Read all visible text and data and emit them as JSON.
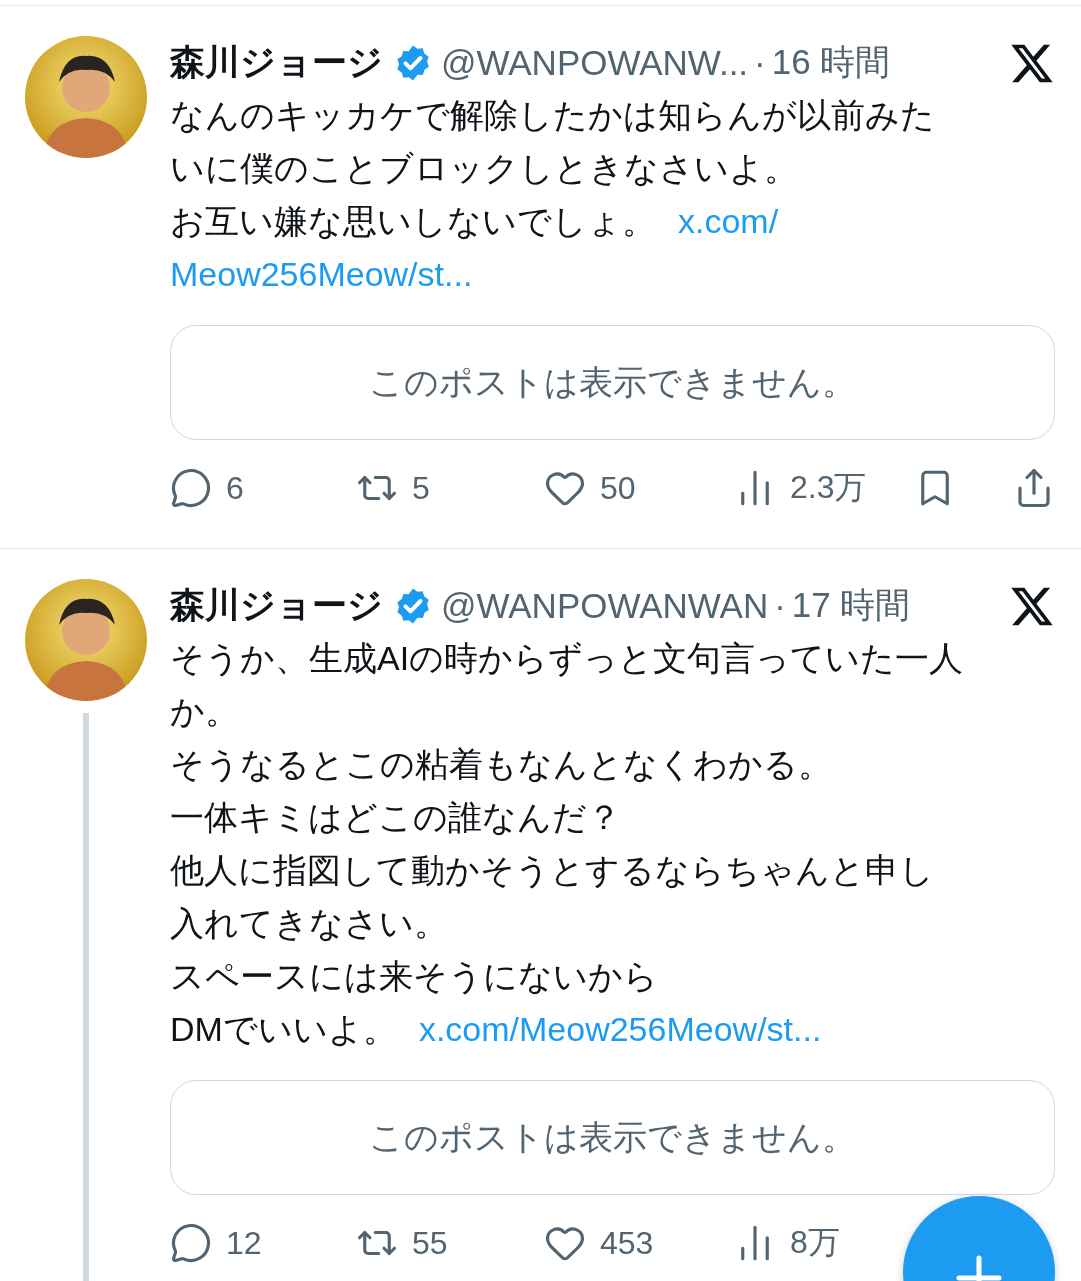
{
  "posts": [
    {
      "name": "森川ジョージ",
      "verified": true,
      "handle": "@WANPOWANW...",
      "separator": "·",
      "time": "16 時間",
      "thread": false,
      "lines": [
        "なんのキッカケで解除したかは知らんが以前みた",
        "いに僕のことブロックしときなさいよ。",
        "お互い嫌な思いしないでしょ。"
      ],
      "link_lines": [
        "x.com/",
        "Meow256Meow/st..."
      ],
      "embed": "このポストは表示できません。",
      "actions": [
        {
          "kind": "reply",
          "count": "6"
        },
        {
          "kind": "repost",
          "count": "5"
        },
        {
          "kind": "like",
          "count": "50"
        },
        {
          "kind": "views",
          "count": "2.3万"
        },
        {
          "kind": "bookmark"
        },
        {
          "kind": "share"
        }
      ]
    },
    {
      "name": "森川ジョージ",
      "verified": true,
      "handle": "@WANPOWANWAN",
      "separator": "·",
      "time": "17 時間",
      "thread": true,
      "lines": [
        "そうか、生成AIの時からずっと文句言っていた一人",
        "か。",
        "そうなるとこの粘着もなんとなくわかる。",
        "一体キミはどこの誰なんだ？",
        "他人に指図して動かそうとするならちゃんと申し",
        "入れてきなさい。",
        "スペースには来そうにないから",
        "DMでいいよ。"
      ],
      "link_lines": [
        "x.com/Meow256Meow/st..."
      ],
      "embed": "このポストは表示できません。",
      "actions": [
        {
          "kind": "reply",
          "count": "12"
        },
        {
          "kind": "repost",
          "count": "55"
        },
        {
          "kind": "like",
          "count": "453"
        },
        {
          "kind": "views",
          "count": "8万"
        }
      ]
    }
  ]
}
